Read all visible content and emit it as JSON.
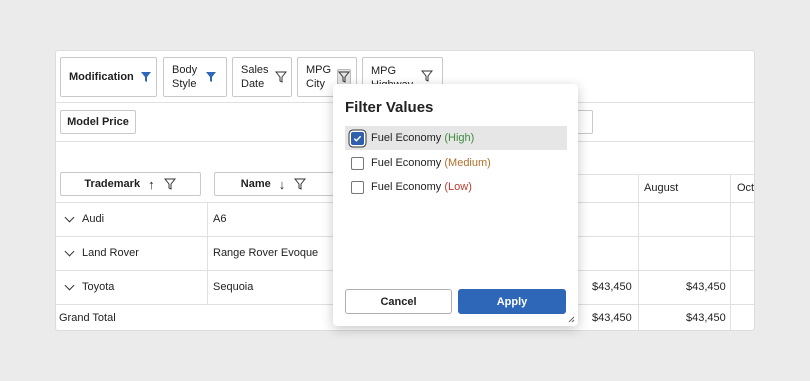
{
  "fields": [
    {
      "label": "Modification",
      "filtered": true
    },
    {
      "label": "Body Style",
      "filtered": true
    },
    {
      "label": "Sales Date",
      "filtered": false
    },
    {
      "label": "MPG City",
      "filtered": false
    },
    {
      "label": "MPG Highway",
      "filtered": false
    }
  ],
  "data_area_button": "Model Price",
  "row_headers": [
    {
      "label": "Trademark",
      "sort": "↑"
    },
    {
      "label": "Name",
      "sort": "↓"
    }
  ],
  "columns": {
    "august": "August",
    "october": "Octo"
  },
  "rows": [
    {
      "trademark": "Audi",
      "name": "A6",
      "col1": "",
      "august": ""
    },
    {
      "trademark": "Land Rover",
      "name": "Range Rover Evoque",
      "col1": "",
      "august": ""
    },
    {
      "trademark": "Toyota",
      "name": "Sequoia",
      "col1": "$43,450",
      "august": "$43,450"
    }
  ],
  "grand_total": {
    "label": "Grand Total",
    "col1": "$43,450",
    "august": "$43,450"
  },
  "filter_popup": {
    "title": "Filter Values",
    "items": [
      {
        "text": "Fuel Economy ",
        "qualifier": "(High)",
        "color": "#3f8a3f",
        "checked": true
      },
      {
        "text": "Fuel Economy ",
        "qualifier": "(Medium)",
        "color": "#b06f2a",
        "checked": false
      },
      {
        "text": "Fuel Economy ",
        "qualifier": "(Low)",
        "color": "#c0392b",
        "checked": false
      }
    ],
    "cancel_label": "Cancel",
    "apply_label": "Apply"
  },
  "colors": {
    "accent": "#2e67b8",
    "filter_active": "#2e67b8"
  }
}
